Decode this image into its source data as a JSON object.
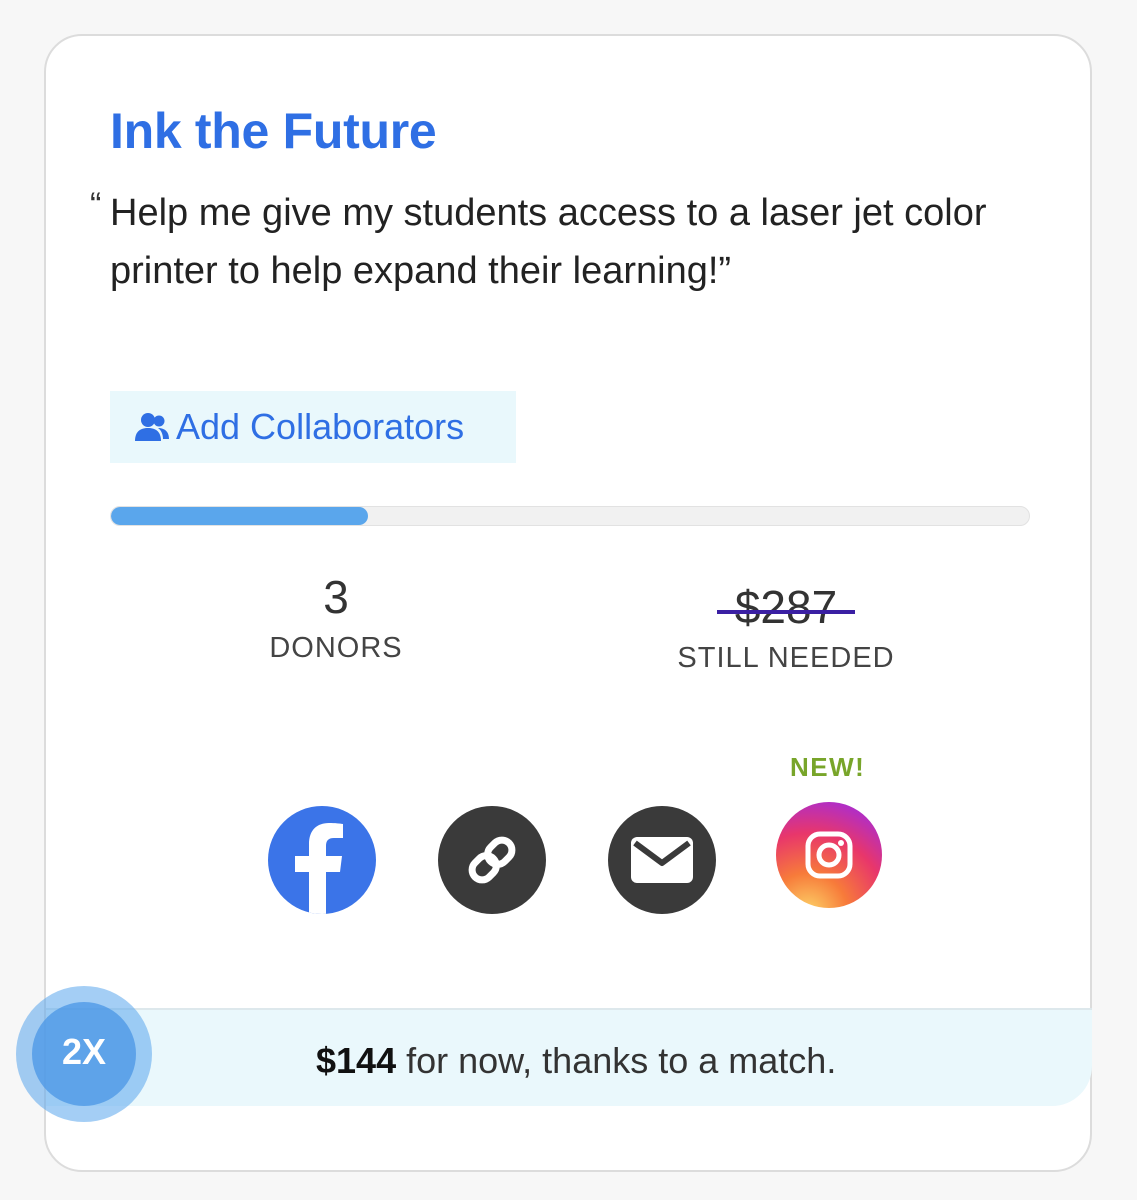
{
  "project": {
    "title": "Ink the Future",
    "quote_open": "“",
    "quote": "Help me give my students access to a laser jet color printer to help expand their learning!”"
  },
  "collaborators": {
    "label": "Add Collaborators",
    "icon": "users-icon"
  },
  "progress": {
    "fraction": 0.28,
    "color": "#5aa6ec"
  },
  "stats": {
    "donors_count": "3",
    "donors_label": "DONORS",
    "needed_amount": "$287",
    "needed_label": "STILL NEEDED"
  },
  "share": {
    "new_badge": "NEW!",
    "buttons": [
      {
        "name": "facebook-icon",
        "color": "#3b74e8"
      },
      {
        "name": "link-icon",
        "color": "#3a3a3a"
      },
      {
        "name": "email-icon",
        "color": "#3a3a3a"
      },
      {
        "name": "instagram-icon",
        "color": "gradient"
      }
    ]
  },
  "match": {
    "badge": "2X",
    "amount": "$144",
    "text": " for now, thanks to a match."
  },
  "colors": {
    "accent": "#2f6fe4",
    "new_badge": "#78a52a",
    "match_bg": "#eaf8fc",
    "strike": "#3a1fa3"
  }
}
